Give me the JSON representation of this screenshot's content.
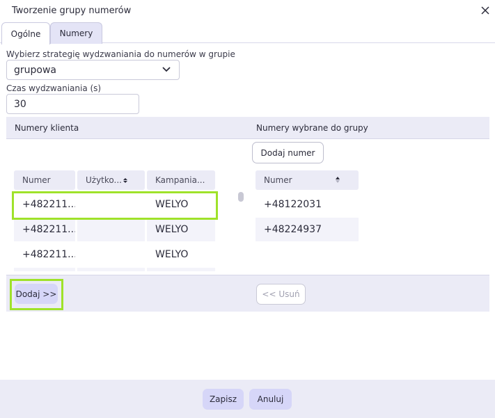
{
  "dialog": {
    "title": "Tworzenie grupy numerów",
    "tabs": [
      {
        "label": "Ogólne",
        "active": true
      },
      {
        "label": "Numery",
        "active": false
      }
    ]
  },
  "form": {
    "strategy_label": "Wybierz strategię wydzwaniania do numerów w grupie",
    "strategy_value": "grupowa",
    "time_label": "Czas wydzwaniania (s)",
    "time_value": "30"
  },
  "client_numbers": {
    "header": "Numery klienta",
    "columns": [
      "Numer",
      "Użytko...",
      "Kampania..."
    ],
    "rows": [
      {
        "numer": "+482211...",
        "uzytkownik": "",
        "kampania": "WELYO"
      },
      {
        "numer": "+482211...",
        "uzytkownik": "",
        "kampania": "WELYO"
      },
      {
        "numer": "+482211...",
        "uzytkownik": "",
        "kampania": "WELYO"
      }
    ],
    "add_button": "Dodaj >>"
  },
  "selected_numbers": {
    "header": "Numery wybrane do grupy",
    "add_number_button": "Dodaj numer",
    "columns": [
      "Numer"
    ],
    "rows": [
      {
        "numer": "+48122031"
      },
      {
        "numer": "+48224937"
      }
    ],
    "remove_button": "<< Usuń"
  },
  "footer": {
    "save_label": "Zapisz",
    "cancel_label": "Anuluj"
  },
  "colors": {
    "accent": "#d6d6f8",
    "highlight": "#9fe22a",
    "panel": "#ebebf6"
  }
}
